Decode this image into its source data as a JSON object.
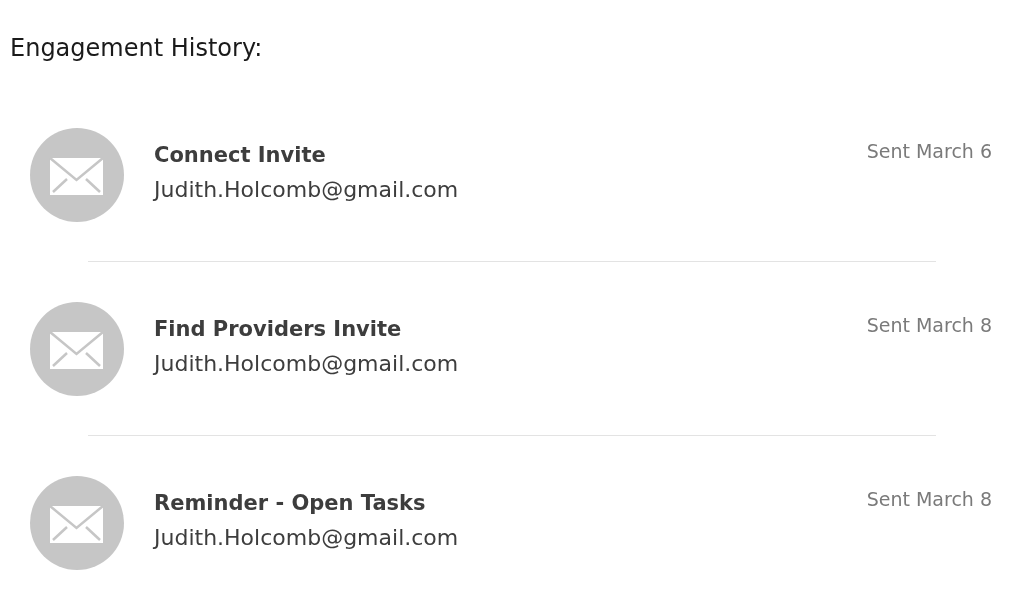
{
  "title": "Engagement History:",
  "entries": [
    {
      "title": "Connect Invite",
      "email": "Judith.Holcomb@gmail.com",
      "date": "Sent March 6"
    },
    {
      "title": "Find Providers Invite",
      "email": "Judith.Holcomb@gmail.com",
      "date": "Sent March 8"
    },
    {
      "title": "Reminder - Open Tasks",
      "email": "Judith.Holcomb@gmail.com",
      "date": "Sent March 8"
    }
  ]
}
